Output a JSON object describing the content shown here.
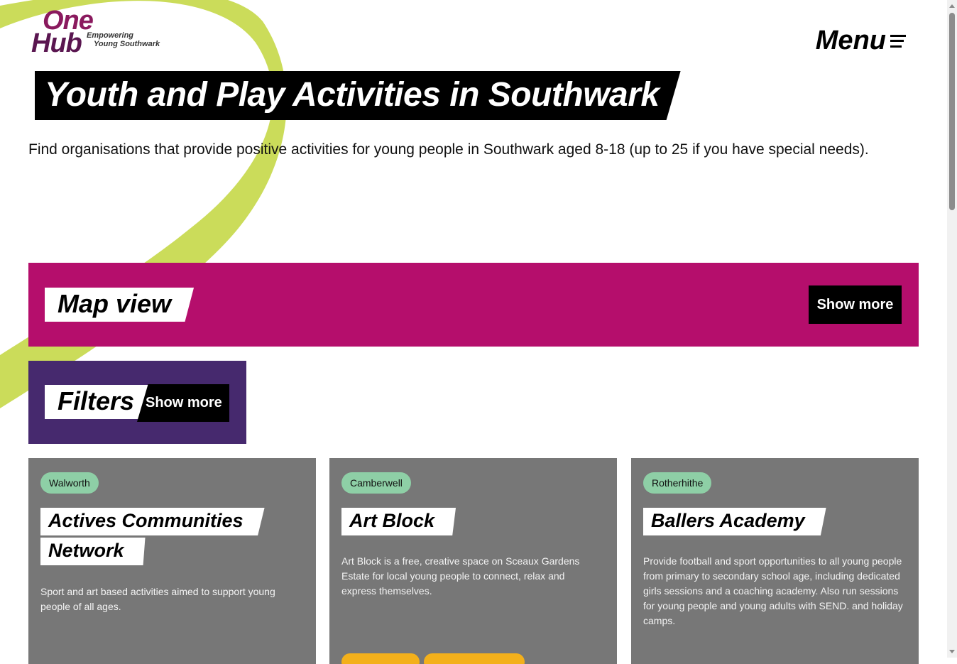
{
  "logo": {
    "line1": "One",
    "line2": "Hub",
    "tagline1": "Empowering",
    "tagline2": "Young Southwark"
  },
  "menu": {
    "label": "Menu"
  },
  "page": {
    "title": "Youth and Play Activities in Southwark",
    "intro": "Find organisations that provide positive activities for young people in Southwark aged 8-18 (up to 25 if you have special needs)."
  },
  "map_panel": {
    "title": "Map view",
    "button_label": "Show more"
  },
  "filters_panel": {
    "title": "Filters",
    "button_label": "Show more"
  },
  "cards": [
    {
      "area": "Walworth",
      "name_lines": [
        "Actives Communities",
        "Network"
      ],
      "description": "Sport and art based activities aimed to support  young people of all ages."
    },
    {
      "area": "Camberwell",
      "name_lines": [
        "Art Block"
      ],
      "description": "Art Block is a free, creative space on Sceaux Gardens Estate for local young people to connect, relax and express themselves."
    },
    {
      "area": "Rotherhithe",
      "name_lines": [
        "Ballers Academy"
      ],
      "description": "Provide football and sport opportunities to all young people from primary to secondary school age, including dedicated girls sessions and a coaching academy.  Also run sessions for young people and young adults with SEND. and holiday camps."
    }
  ],
  "colors": {
    "accent_magenta": "#b50e6c",
    "accent_purple": "#46296e",
    "swoosh_lime": "#cbdc5a",
    "card_grey": "#777777",
    "tag_green": "#8ecfa6",
    "chip_yellow": "#f3b01b"
  },
  "icons": {
    "menu": "hamburger-menu-icon"
  }
}
